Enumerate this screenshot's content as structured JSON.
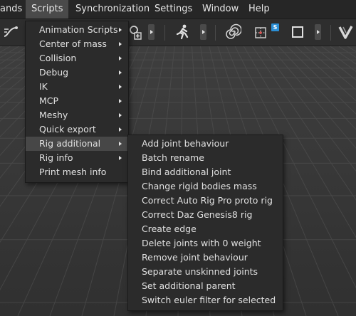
{
  "menubar": {
    "items": [
      {
        "label": "ands"
      },
      {
        "label": "Scripts"
      },
      {
        "label": "Synchronization"
      },
      {
        "label": "Settings"
      },
      {
        "label": "Window"
      },
      {
        "label": "Help"
      }
    ]
  },
  "toolbar": {
    "icons": [
      "curve-icon",
      "add-bone-icon",
      "run-icon",
      "spiral-icon",
      "snap-grid-icon",
      "square-icon",
      "logo-v-icon"
    ],
    "snap_badge": "S"
  },
  "scripts_menu": {
    "items": [
      {
        "label": "Animation Scripts",
        "submenu": true
      },
      {
        "label": "Center of mass",
        "submenu": true
      },
      {
        "label": "Collision",
        "submenu": true
      },
      {
        "label": "Debug",
        "submenu": true
      },
      {
        "label": "IK",
        "submenu": true
      },
      {
        "label": "MCP",
        "submenu": true
      },
      {
        "label": "Meshy",
        "submenu": true
      },
      {
        "label": "Quick export",
        "submenu": true
      },
      {
        "label": "Rig additional",
        "submenu": true,
        "highlighted": true
      },
      {
        "label": "Rig info",
        "submenu": true
      },
      {
        "label": "Print mesh info",
        "submenu": false
      }
    ]
  },
  "rig_additional_menu": {
    "items": [
      {
        "label": "Add joint behaviour"
      },
      {
        "label": "Batch rename"
      },
      {
        "label": "Bind additional joint"
      },
      {
        "label": "Change rigid bodies mass"
      },
      {
        "label": "Correct Auto Rig Pro proto rig"
      },
      {
        "label": "Correct Daz Genesis8 rig"
      },
      {
        "label": "Create edge"
      },
      {
        "label": "Delete joints with 0 weight"
      },
      {
        "label": "Remove joint behaviour"
      },
      {
        "label": "Separate unskinned joints"
      },
      {
        "label": "Set additional parent"
      },
      {
        "label": "Switch euler filter for selected"
      }
    ]
  },
  "colors": {
    "menubar_bg": "#262626",
    "menu_bg": "#2b2b2b",
    "highlight": "#474747",
    "snap_badge": "#2b8fd6"
  }
}
